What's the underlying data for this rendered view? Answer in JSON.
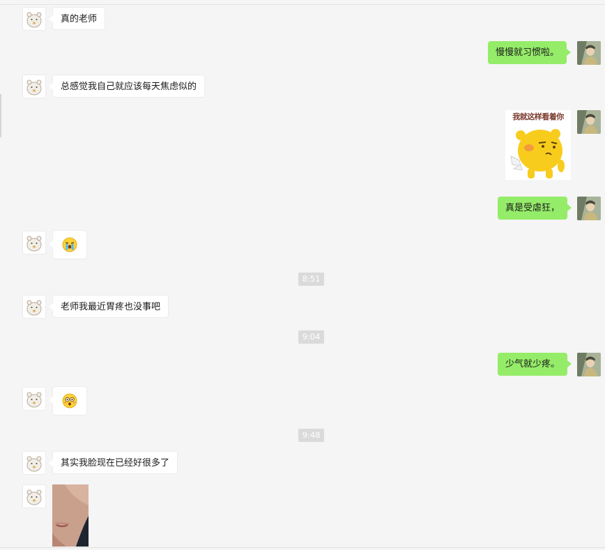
{
  "messages": {
    "m1": "真的老师",
    "m2": "慢慢就习惯啦。",
    "m3": "总感觉我自己就应该每天焦虑似的",
    "m4_sticker_caption": "我就这样看着你",
    "m5": "真是受虐狂，",
    "m7": "老师我最近胃疼也没事吧",
    "m8": "少气就少疼。",
    "m10": "其实我脸现在已经好很多了"
  },
  "timestamps": {
    "t1": "8:51",
    "t2": "9:04",
    "t3": "9:48"
  },
  "icons": {
    "left_avatar": "hamster-avatar-icon",
    "right_avatar": "character-avatar-icon",
    "emoji_1": "crying-face-emoji-icon",
    "emoji_2": "shocked-face-emoji-icon",
    "sticker": "yellow-bear-sticker"
  },
  "colors": {
    "background": "#f5f5f5",
    "outgoing_bubble": "#95ec69",
    "incoming_bubble": "#ffffff",
    "timestamp_bg": "#dadada"
  }
}
